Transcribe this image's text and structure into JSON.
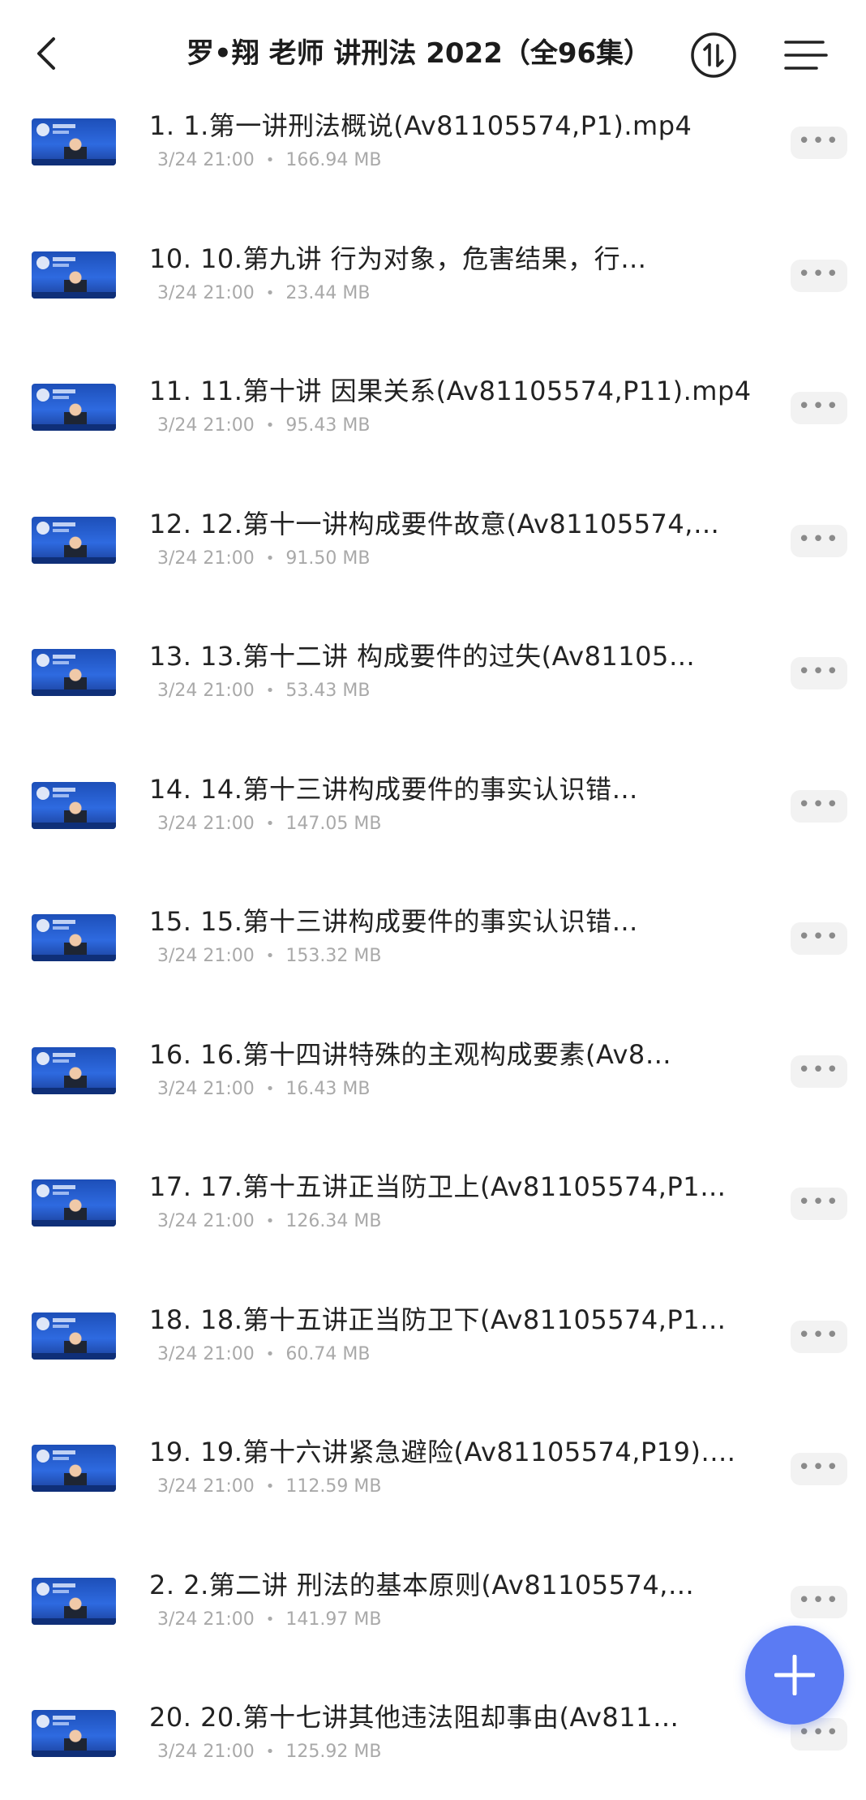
{
  "header": {
    "title": "罗•翔 老师 讲刑法 2022（全96集）",
    "back_icon": "chevron-left-icon",
    "sort_icon": "sort-icon",
    "menu_icon": "menu-icon"
  },
  "files": [
    {
      "name": "1. 1.第一讲刑法概说(Av81105574,P1).mp4",
      "date": "3/24 21:00",
      "size": "166.94 MB"
    },
    {
      "name": "10. 10.第九讲 行为对象，危害结果，行…",
      "date": "3/24 21:00",
      "size": "23.44 MB"
    },
    {
      "name": "11. 11.第十讲 因果关系(Av81105574,P11).mp4",
      "date": "3/24 21:00",
      "size": "95.43 MB"
    },
    {
      "name": "12. 12.第十一讲构成要件故意(Av81105574,…",
      "date": "3/24 21:00",
      "size": "91.50 MB"
    },
    {
      "name": "13. 13.第十二讲 构成要件的过失(Av81105…",
      "date": "3/24 21:00",
      "size": "53.43 MB"
    },
    {
      "name": "14. 14.第十三讲构成要件的事实认识错…",
      "date": "3/24 21:00",
      "size": "147.05 MB"
    },
    {
      "name": "15. 15.第十三讲构成要件的事实认识错…",
      "date": "3/24 21:00",
      "size": "153.32 MB"
    },
    {
      "name": "16. 16.第十四讲特殊的主观构成要素(Av8…",
      "date": "3/24 21:00",
      "size": "16.43 MB"
    },
    {
      "name": "17. 17.第十五讲正当防卫上(Av81105574,P1…",
      "date": "3/24 21:00",
      "size": "126.34 MB"
    },
    {
      "name": "18. 18.第十五讲正当防卫下(Av81105574,P1…",
      "date": "3/24 21:00",
      "size": "60.74 MB"
    },
    {
      "name": "19. 19.第十六讲紧急避险(Av81105574,P19).…",
      "date": "3/24 21:00",
      "size": "112.59 MB"
    },
    {
      "name": "2. 2.第二讲 刑法的基本原则(Av81105574,…",
      "date": "3/24 21:00",
      "size": "141.97 MB"
    },
    {
      "name": "20. 20.第十七讲其他违法阻却事由(Av811…",
      "date": "3/24 21:00",
      "size": "125.92 MB"
    }
  ],
  "more_label": "•••",
  "meta_separator": "•",
  "fab_icon": "plus-icon",
  "colors": {
    "accent": "#5b7bf3",
    "meta": "#a9a9a9",
    "thumb": "#2e6ae0"
  }
}
